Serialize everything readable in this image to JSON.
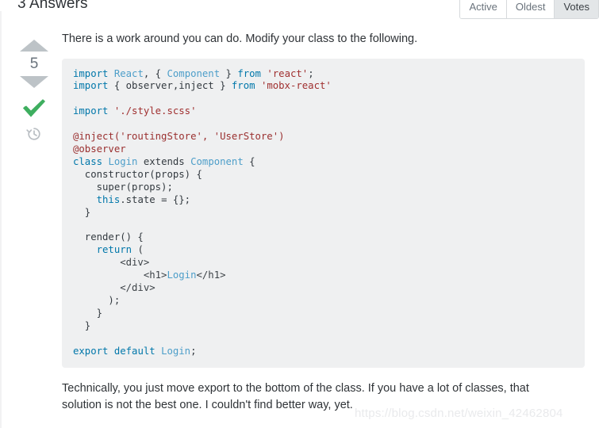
{
  "header": {
    "answers_title": "3 Answers",
    "tabs": [
      {
        "label": "Active",
        "selected": false
      },
      {
        "label": "Oldest",
        "selected": false
      },
      {
        "label": "Votes",
        "selected": true
      }
    ]
  },
  "answer": {
    "vote_count": "5",
    "upvote_icon": "triangle-up-icon",
    "downvote_icon": "triangle-down-icon",
    "accepted_icon": "checkmark-icon",
    "history_icon": "history-clock-icon",
    "intro_text": "There is a work around you can do. Modify your class to the following.",
    "outro_text": "Technically, you just move export to the bottom of the class. If you have a lot of classes, that solution is not the best one. I couldn't find better way, yet.",
    "code_lines": [
      [
        {
          "t": "import",
          "c": "kw2"
        },
        {
          "t": " ",
          "c": "plain"
        },
        {
          "t": "React",
          "c": "type"
        },
        {
          "t": ", { ",
          "c": "plain"
        },
        {
          "t": "Component",
          "c": "type"
        },
        {
          "t": " } ",
          "c": "plain"
        },
        {
          "t": "from",
          "c": "kw2"
        },
        {
          "t": " ",
          "c": "plain"
        },
        {
          "t": "'react'",
          "c": "str"
        },
        {
          "t": ";",
          "c": "plain"
        }
      ],
      [
        {
          "t": "import",
          "c": "kw2"
        },
        {
          "t": " { observer,inject } ",
          "c": "plain"
        },
        {
          "t": "from",
          "c": "kw2"
        },
        {
          "t": " ",
          "c": "plain"
        },
        {
          "t": "'mobx-react'",
          "c": "str"
        }
      ],
      [],
      [
        {
          "t": "import",
          "c": "kw2"
        },
        {
          "t": " ",
          "c": "plain"
        },
        {
          "t": "'./style.scss'",
          "c": "str"
        }
      ],
      [],
      [
        {
          "t": "@inject('routingStore', 'UserStore')",
          "c": "dec"
        }
      ],
      [
        {
          "t": "@observer",
          "c": "dec"
        }
      ],
      [
        {
          "t": "class",
          "c": "kw2"
        },
        {
          "t": " ",
          "c": "plain"
        },
        {
          "t": "Login",
          "c": "type"
        },
        {
          "t": " extends ",
          "c": "plain"
        },
        {
          "t": "Component",
          "c": "type"
        },
        {
          "t": " {",
          "c": "plain"
        }
      ],
      [
        {
          "t": "  constructor(props) {",
          "c": "plain"
        }
      ],
      [
        {
          "t": "    super(props);",
          "c": "plain"
        }
      ],
      [
        {
          "t": "    ",
          "c": "plain"
        },
        {
          "t": "this",
          "c": "kw2"
        },
        {
          "t": ".state = {};",
          "c": "plain"
        }
      ],
      [
        {
          "t": "  }",
          "c": "plain"
        }
      ],
      [],
      [
        {
          "t": "  render() {",
          "c": "plain"
        }
      ],
      [
        {
          "t": "    ",
          "c": "plain"
        },
        {
          "t": "return",
          "c": "kw2"
        },
        {
          "t": " (",
          "c": "plain"
        }
      ],
      [
        {
          "t": "        <div>",
          "c": "tag"
        }
      ],
      [
        {
          "t": "            <h1>",
          "c": "tag"
        },
        {
          "t": "Login",
          "c": "type"
        },
        {
          "t": "</h1>",
          "c": "tag"
        }
      ],
      [
        {
          "t": "        </div>",
          "c": "tag"
        }
      ],
      [
        {
          "t": "      );",
          "c": "plain"
        }
      ],
      [
        {
          "t": "    }",
          "c": "plain"
        }
      ],
      [
        {
          "t": "  }",
          "c": "plain"
        }
      ],
      [],
      [
        {
          "t": "export",
          "c": "kw2"
        },
        {
          "t": " ",
          "c": "plain"
        },
        {
          "t": "default",
          "c": "kw2"
        },
        {
          "t": " ",
          "c": "plain"
        },
        {
          "t": "Login",
          "c": "type"
        },
        {
          "t": ";",
          "c": "plain"
        }
      ]
    ]
  },
  "watermark": {
    "text": "https://blog.csdn.net/weixin_42462804"
  },
  "colors": {
    "accepted_green": "#3eae5f",
    "arrow_gray": "#bdc3c7",
    "code_bg": "#eff0f1",
    "tab_selected_bg": "#e3e6e8",
    "text": "#2f3337"
  }
}
